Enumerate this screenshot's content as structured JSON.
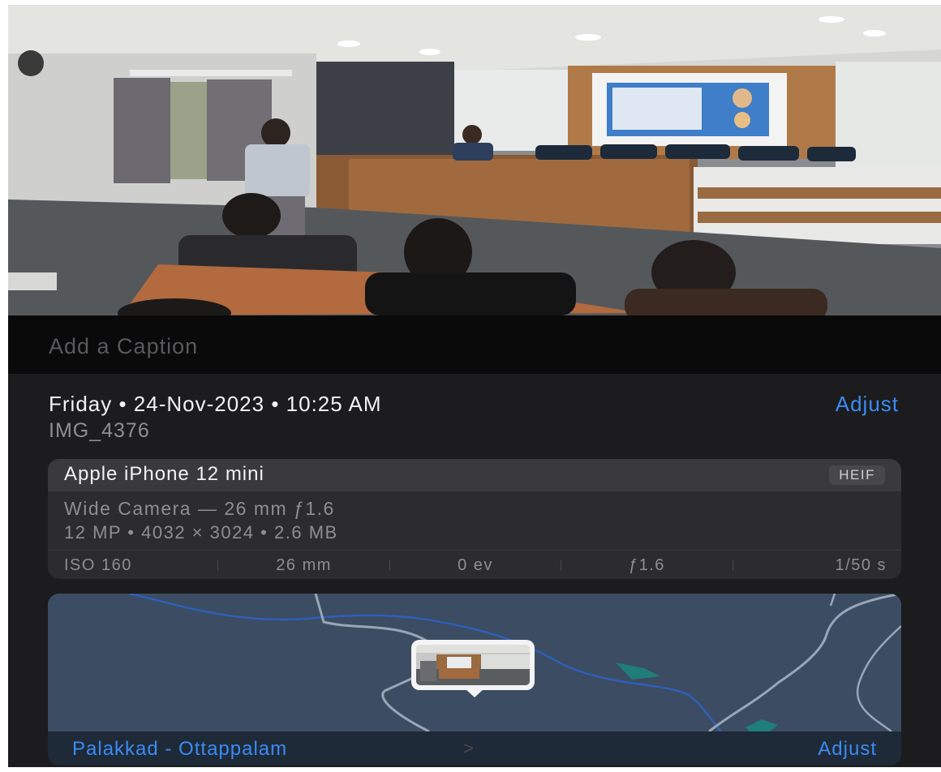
{
  "photo": {
    "description_icon": "photo-icon"
  },
  "caption": {
    "placeholder": "Add a Caption"
  },
  "info": {
    "date_line": "Friday • 24-Nov-2023 • 10:25 AM",
    "adjust_label": "Adjust",
    "file_name": "IMG_4376"
  },
  "camera": {
    "model": "Apple iPhone 12 mini",
    "format_badge": "HEIF",
    "lens": "Wide Camera — 26 mm ƒ1.6",
    "specs": "12 MP • 4032 × 3024 • 2.6 MB",
    "exif": [
      "ISO 160",
      "26 mm",
      "0 ev",
      "ƒ1.6",
      "1/50 s"
    ]
  },
  "map": {
    "location": "Palakkad - Ottappalam",
    "chevron": ">",
    "adjust_label": "Adjust"
  },
  "colors": {
    "accent": "#3a8bf5",
    "card": "#2c2c2e",
    "background": "#1c1c1e"
  }
}
